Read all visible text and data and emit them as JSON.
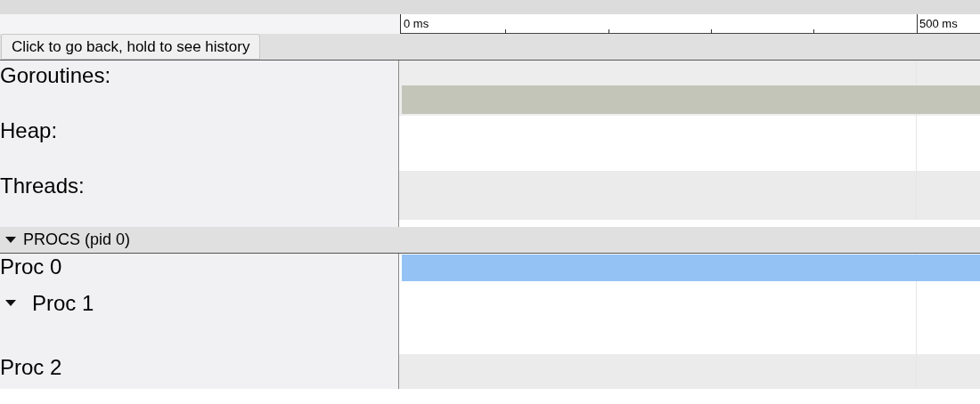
{
  "ruler": {
    "labels": [
      "0 ms",
      "500 ms"
    ]
  },
  "back_button": {
    "label": "Click to go back, hold to see history"
  },
  "counters": [
    {
      "label": "Goroutines:",
      "color": "#c3c5b9"
    },
    {
      "label": "Heap:"
    },
    {
      "label": "Threads:"
    }
  ],
  "procs_group": {
    "label": "PROCS (pid 0)",
    "expanded": true
  },
  "procs": [
    {
      "label": "Proc 0",
      "kind": "plain",
      "color": "#94c2f5"
    },
    {
      "label": "Proc 1",
      "kind": "expandable",
      "expanded": true
    },
    {
      "label": "Proc 2",
      "kind": "plain"
    }
  ]
}
